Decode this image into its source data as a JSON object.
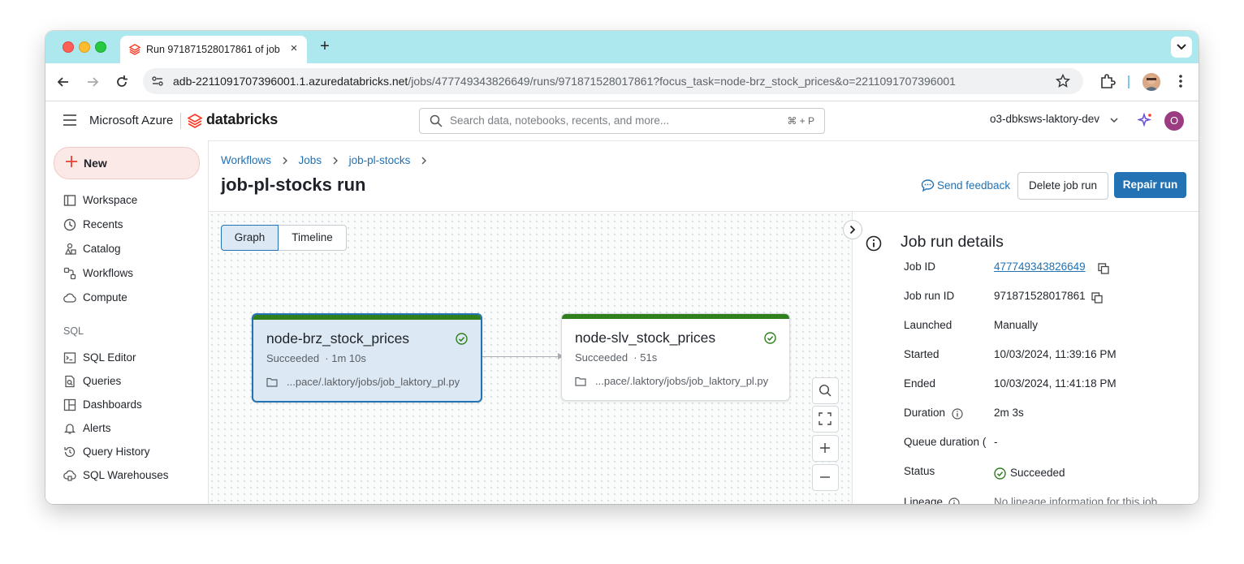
{
  "browser": {
    "tab_title": "Run 971871528017861 of job",
    "new_tab": "+",
    "url_host": "adb-2211091707396001.1.azuredatabricks.net",
    "url_path": "/jobs/477749343826649/runs/971871528017861?focus_task=node-brz_stock_prices&o=2211091707396001"
  },
  "header": {
    "ms_azure": "Microsoft Azure",
    "brand": "databricks",
    "search_placeholder": "Search data, notebooks, recents, and more...",
    "search_shortcut": "⌘ + P",
    "workspace": "o3-dbksws-laktory-dev",
    "avatar_initial": "O"
  },
  "sidebar": {
    "new_label": "New",
    "items": [
      {
        "label": "Workspace",
        "icon": "workspace-icon"
      },
      {
        "label": "Recents",
        "icon": "clock-icon"
      },
      {
        "label": "Catalog",
        "icon": "catalog-icon"
      },
      {
        "label": "Workflows",
        "icon": "workflows-icon"
      },
      {
        "label": "Compute",
        "icon": "cloud-icon"
      }
    ],
    "sql_section": "SQL",
    "sql_items": [
      {
        "label": "SQL Editor",
        "icon": "sql-editor-icon"
      },
      {
        "label": "Queries",
        "icon": "queries-icon"
      },
      {
        "label": "Dashboards",
        "icon": "dashboards-icon"
      },
      {
        "label": "Alerts",
        "icon": "bell-icon"
      },
      {
        "label": "Query History",
        "icon": "history-icon"
      },
      {
        "label": "SQL Warehouses",
        "icon": "warehouse-icon"
      }
    ]
  },
  "main": {
    "breadcrumb": [
      "Workflows",
      "Jobs",
      "job-pl-stocks"
    ],
    "title": "job-pl-stocks run",
    "send_feedback": "Send feedback",
    "delete_run": "Delete job run",
    "repair_run": "Repair run",
    "view_toggle": {
      "graph": "Graph",
      "timeline": "Timeline"
    },
    "nodes": [
      {
        "name": "node-brz_stock_prices",
        "status": "Succeeded",
        "duration": "· 1m 10s",
        "path": "...pace/.laktory/jobs/job_laktory_pl.py"
      },
      {
        "name": "node-slv_stock_prices",
        "status": "Succeeded",
        "duration": "· 51s",
        "path": "...pace/.laktory/jobs/job_laktory_pl.py"
      }
    ]
  },
  "details": {
    "title": "Job run details",
    "rows": [
      {
        "label": "Job ID",
        "value": "477749343826649"
      },
      {
        "label": "Job run ID",
        "value": "971871528017861"
      },
      {
        "label": "Launched",
        "value": "Manually"
      },
      {
        "label": "Started",
        "value": "10/03/2024, 11:39:16 PM"
      },
      {
        "label": "Ended",
        "value": "10/03/2024, 11:41:18 PM"
      },
      {
        "label": "Duration",
        "value": "2m 3s"
      },
      {
        "label": "Queue duration (",
        "value": "-"
      },
      {
        "label": "Status",
        "value": "Succeeded"
      },
      {
        "label": "Lineage",
        "value": "No lineage information for this job"
      }
    ]
  },
  "colors": {
    "accent": "#2272b4",
    "success": "#2f7f1c",
    "brand": "#ff3621"
  }
}
